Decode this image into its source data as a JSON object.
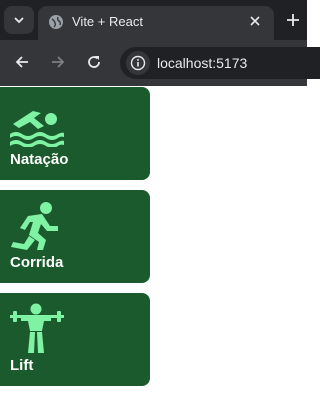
{
  "browser": {
    "tab": {
      "title": "Vite + React",
      "favicon_icon": "globe-icon",
      "close_icon": "close-icon"
    },
    "tab_search_icon": "chevron-down-icon",
    "new_tab_icon": "plus-icon",
    "nav": {
      "back_icon": "arrow-left-icon",
      "forward_icon": "arrow-right-icon",
      "reload_icon": "reload-icon"
    },
    "site_info_icon": "info-icon",
    "url": "localhost:5173"
  },
  "colors": {
    "card_background": "#1a5a2c",
    "icon_green": "#7ff2a4",
    "label_white": "#ffffff",
    "chrome_dark": "#202124",
    "chrome_mid": "#35363a"
  },
  "activities": [
    {
      "label": "Natação",
      "icon": "swimmer-icon"
    },
    {
      "label": "Corrida",
      "icon": "runner-icon"
    },
    {
      "label": "Lift",
      "icon": "weightlifter-icon"
    }
  ]
}
